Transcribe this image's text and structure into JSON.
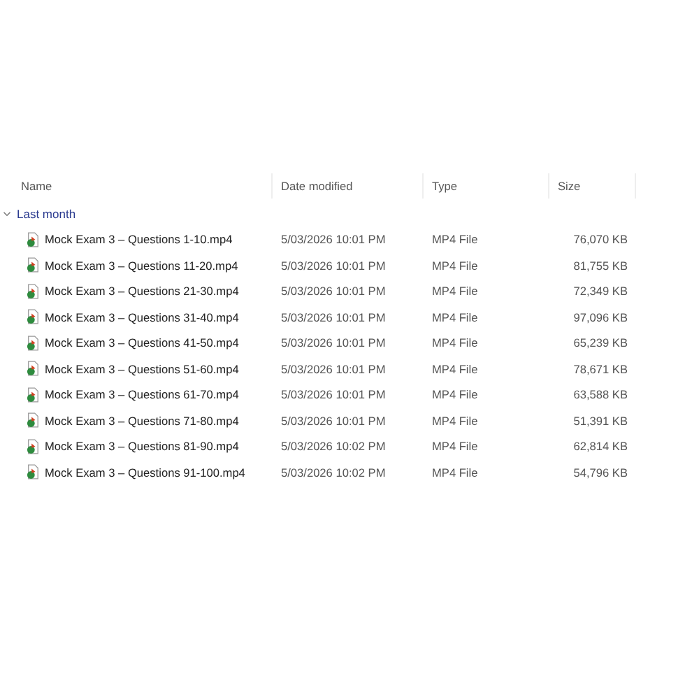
{
  "columns": [
    "Name",
    "Date modified",
    "Type",
    "Size"
  ],
  "group": {
    "label": "Last month",
    "expanded": true
  },
  "files": [
    {
      "name": "Mock Exam 3 – Questions 1-10.mp4",
      "date": "5/03/2026 10:01 PM",
      "type": "MP4 File",
      "size": "76,070 KB"
    },
    {
      "name": "Mock Exam 3 – Questions 11-20.mp4",
      "date": "5/03/2026 10:01 PM",
      "type": "MP4 File",
      "size": "81,755 KB"
    },
    {
      "name": "Mock Exam 3 – Questions 21-30.mp4",
      "date": "5/03/2026 10:01 PM",
      "type": "MP4 File",
      "size": "72,349 KB"
    },
    {
      "name": "Mock Exam 3 – Questions 31-40.mp4",
      "date": "5/03/2026 10:01 PM",
      "type": "MP4 File",
      "size": "97,096 KB"
    },
    {
      "name": "Mock Exam 3 – Questions 41-50.mp4",
      "date": "5/03/2026 10:01 PM",
      "type": "MP4 File",
      "size": "65,239 KB"
    },
    {
      "name": "Mock Exam 3 – Questions 51-60.mp4",
      "date": "5/03/2026 10:01 PM",
      "type": "MP4 File",
      "size": "78,671 KB"
    },
    {
      "name": "Mock Exam 3 – Questions 61-70.mp4",
      "date": "5/03/2026 10:01 PM",
      "type": "MP4 File",
      "size": "63,588 KB"
    },
    {
      "name": "Mock Exam 3 – Questions 71-80.mp4",
      "date": "5/03/2026 10:01 PM",
      "type": "MP4 File",
      "size": "51,391 KB"
    },
    {
      "name": "Mock Exam 3 – Questions 81-90.mp4",
      "date": "5/03/2026 10:02 PM",
      "type": "MP4 File",
      "size": "62,814 KB"
    },
    {
      "name": "Mock Exam 3 – Questions 91-100.mp4",
      "date": "5/03/2026 10:02 PM",
      "type": "MP4 File",
      "size": "54,796 KB"
    }
  ]
}
